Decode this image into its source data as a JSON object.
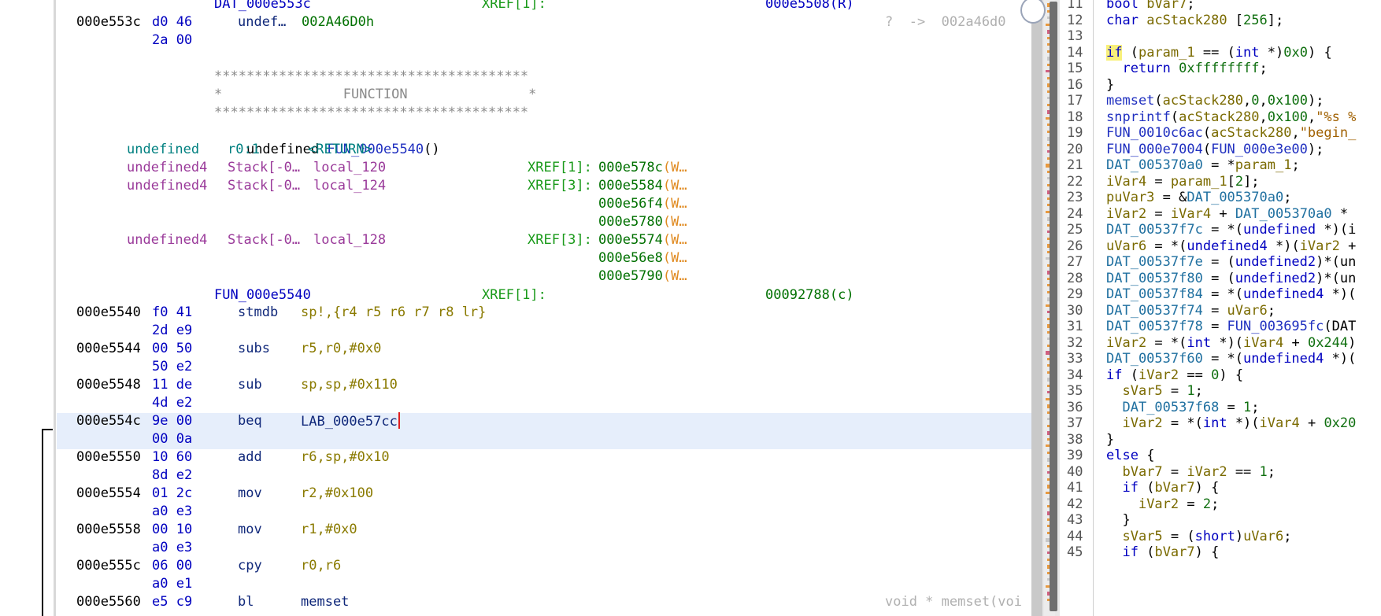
{
  "listing": {
    "top_label": {
      "name": "DAT_000e553c",
      "xref": "XREF[1]:",
      "xref_target": "000e5508(R)"
    },
    "data_row": {
      "addr": "000e553c",
      "bytes1": "d0 46",
      "bytes2": "2a 00",
      "mnemonic": "undef…",
      "operand": "002A46D0h",
      "hint": "?  ->  002a46d0"
    },
    "banner": {
      "stars": "***************************************",
      "title": "*               FUNCTION               *"
    },
    "signature": {
      "ret": "undefined",
      "name": "FUN_000e5540",
      "args": "()"
    },
    "params": [
      {
        "type": "undefined",
        "storage": "r0:1",
        "name": "<RETURN>",
        "xref": "",
        "targets": []
      },
      {
        "type": "undefined4",
        "storage": "Stack[-0…",
        "name": "local_120",
        "xref": "XREF[1]:",
        "targets": [
          {
            "addr": "000e578c",
            "acc": "(W…"
          }
        ]
      },
      {
        "type": "undefined4",
        "storage": "Stack[-0…",
        "name": "local_124",
        "xref": "XREF[3]:",
        "targets": [
          {
            "addr": "000e5584",
            "acc": "(W…"
          },
          {
            "addr": "000e56f4",
            "acc": "(W…"
          },
          {
            "addr": "000e5780",
            "acc": "(W…"
          }
        ]
      },
      {
        "type": "undefined4",
        "storage": "Stack[-0…",
        "name": "local_128",
        "xref": "XREF[3]:",
        "targets": [
          {
            "addr": "000e5574",
            "acc": "(W…"
          },
          {
            "addr": "000e56e8",
            "acc": "(W…"
          },
          {
            "addr": "000e5790",
            "acc": "(W…"
          }
        ]
      }
    ],
    "func_label": {
      "name": "FUN_000e5540",
      "xref": "XREF[1]:",
      "xref_target": "00092788(c)"
    },
    "instructions": [
      {
        "addr": "000e5540",
        "b1": "f0 41",
        "b2": "2d e9",
        "mn": "stmdb",
        "op": "sp!,{r4 r5 r6 r7 r8 lr}"
      },
      {
        "addr": "000e5544",
        "b1": "00 50",
        "b2": "50 e2",
        "mn": "subs",
        "op": "r5,r0,#0x0"
      },
      {
        "addr": "000e5548",
        "b1": "11 de",
        "b2": "4d e2",
        "mn": "sub",
        "op": "sp,sp,#0x110"
      },
      {
        "addr": "000e554c",
        "b1": "9e 00",
        "b2": "00 0a",
        "mn": "beq",
        "op": "LAB_000e57cc"
      },
      {
        "addr": "000e5550",
        "b1": "10 60",
        "b2": "8d e2",
        "mn": "add",
        "op": "r6,sp,#0x10"
      },
      {
        "addr": "000e5554",
        "b1": "01 2c",
        "b2": "a0 e3",
        "mn": "mov",
        "op": "r2,#0x100"
      },
      {
        "addr": "000e5558",
        "b1": "00 10",
        "b2": "a0 e3",
        "mn": "mov",
        "op": "r1,#0x0"
      },
      {
        "addr": "000e555c",
        "b1": "06 00",
        "b2": "a0 e1",
        "mn": "cpy",
        "op": "r0,r6"
      },
      {
        "addr": "000e5560",
        "b1": "e5 c9",
        "b2": "",
        "mn": "bl",
        "op": "memset"
      }
    ],
    "call_hint": "void * memset(voi"
  },
  "decompiler": {
    "lines": [
      {
        "n": "11",
        "t": "bool bVar7;"
      },
      {
        "n": "12",
        "t": "char acStack280 [256];"
      },
      {
        "n": "13",
        "t": ""
      },
      {
        "n": "14",
        "t": "if (param_1 == (int *)0x0) {"
      },
      {
        "n": "15",
        "t": "  return 0xffffffff;"
      },
      {
        "n": "16",
        "t": "}"
      },
      {
        "n": "17",
        "t": "memset(acStack280,0,0x100);"
      },
      {
        "n": "18",
        "t": "snprintf(acStack280,0x100,\"%s %"
      },
      {
        "n": "19",
        "t": "FUN_0010c6ac(acStack280,\"begin_"
      },
      {
        "n": "20",
        "t": "FUN_000e7004(FUN_000e3e00);"
      },
      {
        "n": "21",
        "t": "DAT_005370a0 = *param_1;"
      },
      {
        "n": "22",
        "t": "iVar4 = param_1[2];"
      },
      {
        "n": "23",
        "t": "puVar3 = &DAT_005370a0;"
      },
      {
        "n": "24",
        "t": "iVar2 = iVar4 + DAT_005370a0 *"
      },
      {
        "n": "25",
        "t": "DAT_00537f7c = *(undefined *)(i"
      },
      {
        "n": "26",
        "t": "uVar6 = *(undefined4 *)(iVar2 +"
      },
      {
        "n": "27",
        "t": "DAT_00537f7e = (undefined2)*(un"
      },
      {
        "n": "28",
        "t": "DAT_00537f80 = (undefined2)*(un"
      },
      {
        "n": "29",
        "t": "DAT_00537f84 = *(undefined4 *)("
      },
      {
        "n": "30",
        "t": "DAT_00537f74 = uVar6;"
      },
      {
        "n": "31",
        "t": "DAT_00537f78 = FUN_003695fc(DAT"
      },
      {
        "n": "32",
        "t": "iVar2 = *(int *)(iVar4 + 0x244)"
      },
      {
        "n": "33",
        "t": "DAT_00537f60 = *(undefined4 *)("
      },
      {
        "n": "34",
        "t": "if (iVar2 == 0) {"
      },
      {
        "n": "35",
        "t": "  sVar5 = 1;"
      },
      {
        "n": "36",
        "t": "  DAT_00537f68 = 1;"
      },
      {
        "n": "37",
        "t": "  iVar2 = *(int *)(iVar4 + 0x20"
      },
      {
        "n": "38",
        "t": "}"
      },
      {
        "n": "39",
        "t": "else {"
      },
      {
        "n": "40",
        "t": "  bVar7 = iVar2 == 1;"
      },
      {
        "n": "41",
        "t": "  if (bVar7) {"
      },
      {
        "n": "42",
        "t": "    iVar2 = 2;"
      },
      {
        "n": "43",
        "t": "  }"
      },
      {
        "n": "44",
        "t": "  sVar5 = (short)uVar6;"
      },
      {
        "n": "45",
        "t": "  if (bVar7) {"
      }
    ]
  }
}
